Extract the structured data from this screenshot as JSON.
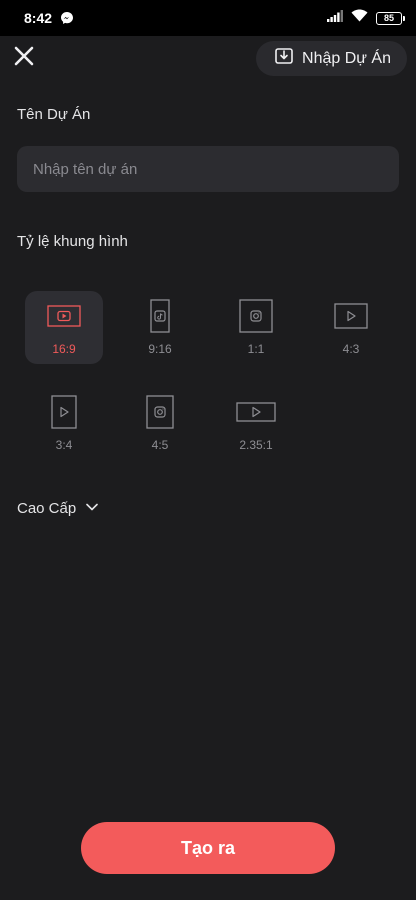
{
  "status_bar": {
    "time": "8:42",
    "battery": "85",
    "icons": [
      "messenger-icon",
      "signal-icon",
      "wifi-icon",
      "battery-icon"
    ]
  },
  "header": {
    "close_icon": "close-icon",
    "import_label": "Nhập Dự Án",
    "import_icon": "import-icon"
  },
  "project_name": {
    "label": "Tên Dự Án",
    "placeholder": "Nhập tên dự án",
    "value": ""
  },
  "aspect_ratio": {
    "label": "Tỷ lệ khung hình",
    "options": [
      {
        "label": "16:9",
        "icon": "youtube-icon",
        "selected": true
      },
      {
        "label": "9:16",
        "icon": "tiktok-icon",
        "selected": false
      },
      {
        "label": "1:1",
        "icon": "instagram-icon",
        "selected": false
      },
      {
        "label": "4:3",
        "icon": "play-icon",
        "selected": false
      },
      {
        "label": "3:4",
        "icon": "play-icon",
        "selected": false
      },
      {
        "label": "4:5",
        "icon": "instagram-icon",
        "selected": false
      },
      {
        "label": "2.35:1",
        "icon": "play-icon",
        "selected": false
      }
    ]
  },
  "advanced": {
    "label": "Cao Cấp",
    "icon": "chevron-down-icon"
  },
  "create_button": {
    "label": "Tạo ra"
  },
  "colors": {
    "background": "#1c1c1e",
    "accent": "#f35b5b",
    "selected_label": "#f05a5a",
    "muted_text": "#8e8e93"
  }
}
